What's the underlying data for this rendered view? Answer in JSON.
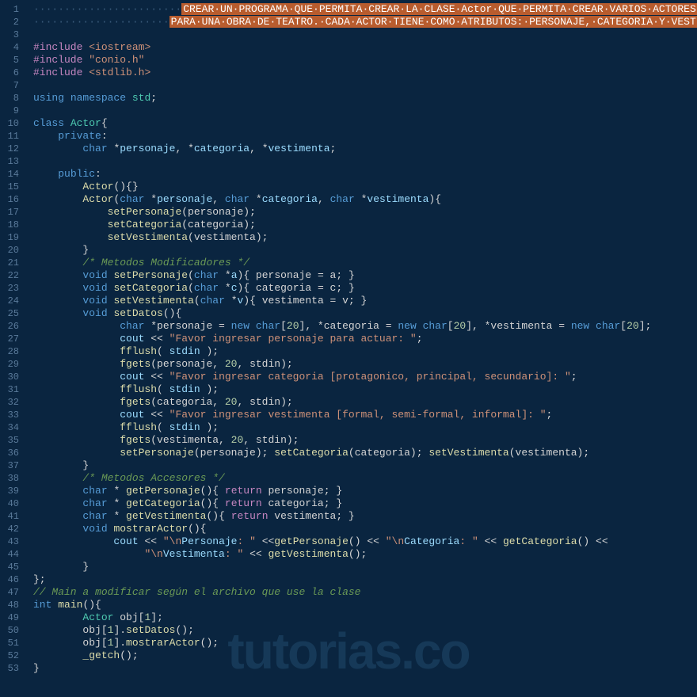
{
  "watermark": "tutorias.co",
  "lines": [
    {
      "n": 1,
      "html": "<span class='hl-dot'>························</span><span class='hl-comment-bg'>CREAR·UN·PROGRAMA·QUE·PERMITA·CREAR·LA·CLASE·Actor·QUE·PERMITA·CREAR·VARIOS·ACTORES</span>"
    },
    {
      "n": 2,
      "html": "<span class='hl-dot'>······················</span><span class='hl-comment-bg'>PARA·UNA·OBRA·DE·TEATRO.·CADA·ACTOR·TIENE·COMO·ATRIBUTOS:·PERSONAJE,·CATEGORIA·Y·VESTIMENTA</span>"
    },
    {
      "n": 3,
      "html": ""
    },
    {
      "n": 4,
      "html": "<span class='kw'>#include</span> <span class='str'>&lt;iostream&gt;</span>"
    },
    {
      "n": 5,
      "html": "<span class='kw'>#include</span> <span class='str'>\"conio.h\"</span>"
    },
    {
      "n": 6,
      "html": "<span class='kw'>#include</span> <span class='str'>&lt;stdlib.h&gt;</span>"
    },
    {
      "n": 7,
      "html": ""
    },
    {
      "n": 8,
      "html": "<span class='kw2'>using</span> <span class='kw2'>namespace</span> <span class='type'>std</span>;"
    },
    {
      "n": 9,
      "html": ""
    },
    {
      "n": 10,
      "html": "<span class='kw2'>class</span> <span class='type'>Actor</span>{"
    },
    {
      "n": 11,
      "html": "    <span class='kw2'>private</span>:"
    },
    {
      "n": 12,
      "html": "        <span class='kw2'>char</span> *<span class='ident'>personaje</span>, *<span class='ident'>categoria</span>, *<span class='ident'>vestimenta</span>;"
    },
    {
      "n": 13,
      "html": ""
    },
    {
      "n": 14,
      "html": "    <span class='kw2'>public</span>:"
    },
    {
      "n": 15,
      "html": "        <span class='fn'>Actor</span>(){}"
    },
    {
      "n": 16,
      "html": "        <span class='fn'>Actor</span>(<span class='kw2'>char</span> *<span class='ident'>personaje</span>, <span class='kw2'>char</span> *<span class='ident'>categoria</span>, <span class='kw2'>char</span> *<span class='ident'>vestimenta</span>){"
    },
    {
      "n": 17,
      "html": "            <span class='fn'>setPersonaje</span>(personaje);"
    },
    {
      "n": 18,
      "html": "            <span class='fn'>setCategoria</span>(categoria);"
    },
    {
      "n": 19,
      "html": "            <span class='fn'>setVestimenta</span>(vestimenta);"
    },
    {
      "n": 20,
      "html": "        }"
    },
    {
      "n": 21,
      "html": "        <span class='cmt'>/* Metodos Modificadores */</span>"
    },
    {
      "n": 22,
      "html": "        <span class='kw2'>void</span> <span class='fn'>setPersonaje</span>(<span class='kw2'>char</span> *<span class='ident'>a</span>){ personaje = a; }"
    },
    {
      "n": 23,
      "html": "        <span class='kw2'>void</span> <span class='fn'>setCategoria</span>(<span class='kw2'>char</span> *<span class='ident'>c</span>){ categoria = c; }"
    },
    {
      "n": 24,
      "html": "        <span class='kw2'>void</span> <span class='fn'>setVestimenta</span>(<span class='kw2'>char</span> *<span class='ident'>v</span>){ vestimenta = v; }"
    },
    {
      "n": 25,
      "html": "        <span class='kw2'>void</span> <span class='fn'>setDatos</span>(){"
    },
    {
      "n": 26,
      "html": "              <span class='kw2'>char</span> *personaje = <span class='kw2'>new</span> <span class='kw2'>char</span>[<span class='num'>20</span>], *categoria = <span class='kw2'>new</span> <span class='kw2'>char</span>[<span class='num'>20</span>], *vestimenta = <span class='kw2'>new</span> <span class='kw2'>char</span>[<span class='num'>20</span>];"
    },
    {
      "n": 27,
      "html": "              <span class='ident'>cout</span> &lt;&lt; <span class='str'>\"Favor ingresar personaje para actuar: \"</span>;"
    },
    {
      "n": 28,
      "html": "              <span class='fn'>fflush</span>( <span class='ident'>stdin</span> );"
    },
    {
      "n": 29,
      "html": "              <span class='fn'>fgets</span>(personaje, <span class='num'>20</span>, stdin);"
    },
    {
      "n": 30,
      "html": "              <span class='ident'>cout</span> &lt;&lt; <span class='str'>\"Favor ingresar categoria [protagonico, principal, secundario]: \"</span>;"
    },
    {
      "n": 31,
      "html": "              <span class='fn'>fflush</span>( <span class='ident'>stdin</span> );"
    },
    {
      "n": 32,
      "html": "              <span class='fn'>fgets</span>(categoria, <span class='num'>20</span>, stdin);"
    },
    {
      "n": 33,
      "html": "              <span class='ident'>cout</span> &lt;&lt; <span class='str'>\"Favor ingresar vestimenta [formal, semi-formal, informal]: \"</span>;"
    },
    {
      "n": 34,
      "html": "              <span class='fn'>fflush</span>( <span class='ident'>stdin</span> );"
    },
    {
      "n": 35,
      "html": "              <span class='fn'>fgets</span>(vestimenta, <span class='num'>20</span>, stdin);"
    },
    {
      "n": 36,
      "html": "              <span class='fn'>setPersonaje</span>(personaje); <span class='fn'>setCategoria</span>(categoria); <span class='fn'>setVestimenta</span>(vestimenta);"
    },
    {
      "n": 37,
      "html": "        }"
    },
    {
      "n": 38,
      "html": "        <span class='cmt'>/* Metodos Accesores */</span>"
    },
    {
      "n": 39,
      "html": "        <span class='kw2'>char</span> * <span class='fn'>getPersonaje</span>(){ <span class='kw'>return</span> personaje; }"
    },
    {
      "n": 40,
      "html": "        <span class='kw2'>char</span> * <span class='fn'>getCategoria</span>(){ <span class='kw'>return</span> categoria; }"
    },
    {
      "n": 41,
      "html": "        <span class='kw2'>char</span> * <span class='fn'>getVestimenta</span>(){ <span class='kw'>return</span> vestimenta; }"
    },
    {
      "n": 42,
      "html": "        <span class='kw2'>void</span> <span class='fn'>mostrarActor</span>(){"
    },
    {
      "n": 43,
      "html": "             <span class='ident'>cout</span> &lt;&lt; <span class='str'>\"\\n</span><span class='ident'>Personaje</span><span class='str'>: \"</span> &lt;&lt;<span class='fn'>getPersonaje</span>() &lt;&lt; <span class='str'>\"\\n</span><span class='ident'>Categoria</span><span class='str'>: \"</span> &lt;&lt; <span class='fn'>getCategoria</span>() &lt;&lt;"
    },
    {
      "n": 44,
      "html": "                  <span class='str'>\"\\n</span><span class='ident'>Vestimenta</span><span class='str'>: \"</span> &lt;&lt; <span class='fn'>getVestimenta</span>();"
    },
    {
      "n": 45,
      "html": "        }"
    },
    {
      "n": 46,
      "html": "};"
    },
    {
      "n": 47,
      "html": "<span class='cmt'>// Main a modificar según el archivo que use la clase</span>"
    },
    {
      "n": 48,
      "html": "<span class='kw2'>int</span> <span class='fn'>main</span>(){"
    },
    {
      "n": 49,
      "html": "        <span class='type'>Actor</span> obj[<span class='num'>1</span>];"
    },
    {
      "n": 50,
      "html": "        obj[<span class='num'>1</span>].<span class='fn'>setDatos</span>();"
    },
    {
      "n": 51,
      "html": "        obj[<span class='num'>1</span>].<span class='fn'>mostrarActor</span>();"
    },
    {
      "n": 52,
      "html": "        <span class='fn'>_getch</span>();"
    },
    {
      "n": 53,
      "html": "}"
    }
  ]
}
